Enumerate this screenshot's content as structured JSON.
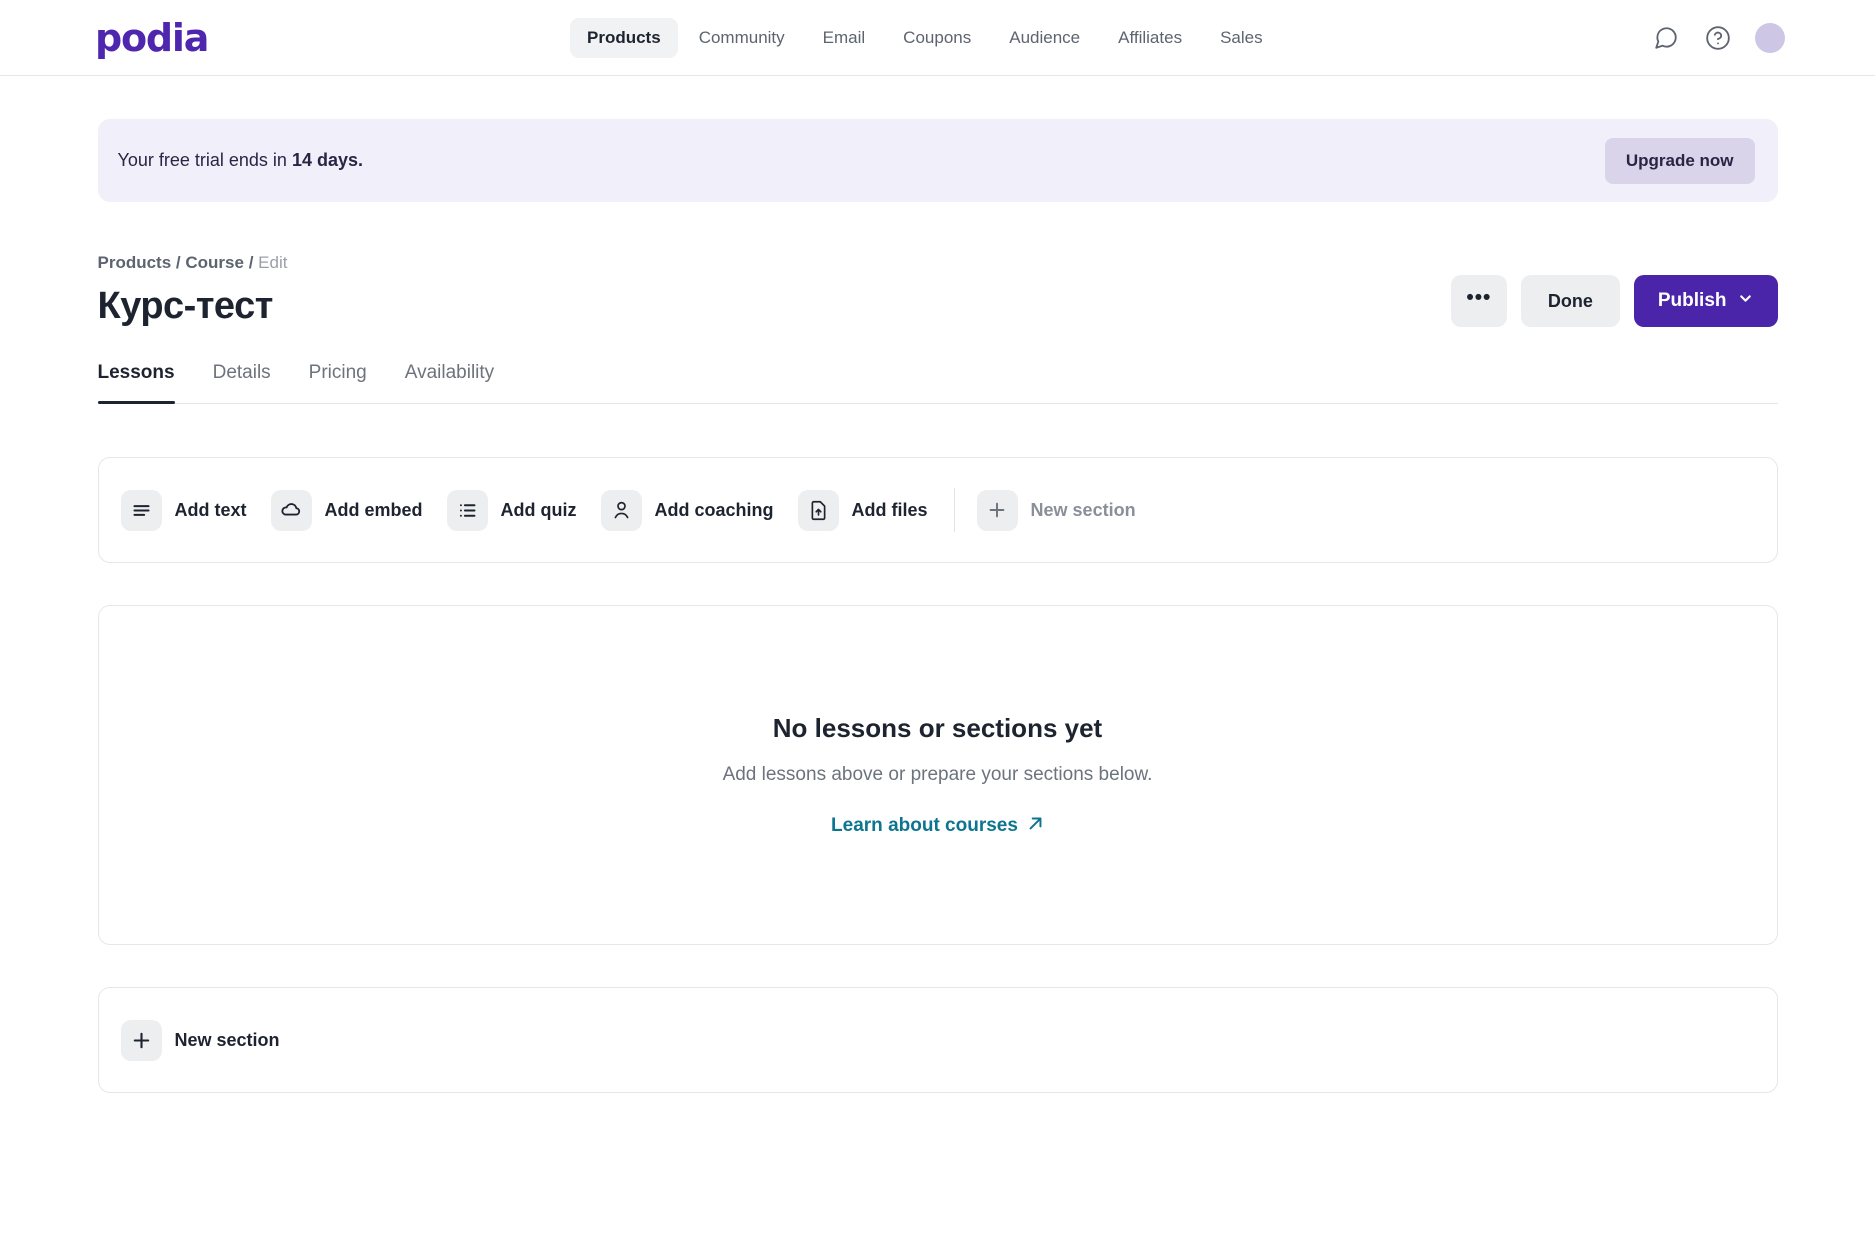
{
  "header": {
    "logo": "podia",
    "nav": [
      {
        "label": "Products",
        "active": true
      },
      {
        "label": "Community",
        "active": false
      },
      {
        "label": "Email",
        "active": false
      },
      {
        "label": "Coupons",
        "active": false
      },
      {
        "label": "Audience",
        "active": false
      },
      {
        "label": "Affiliates",
        "active": false
      },
      {
        "label": "Sales",
        "active": false
      }
    ],
    "icons": [
      "chat-bubble-icon",
      "help-circle-icon",
      "avatar"
    ]
  },
  "banner": {
    "text_prefix": "Your free trial ends in ",
    "text_strong": "14 days.",
    "upgrade_label": "Upgrade now",
    "background": "#f1eff9",
    "button_background": "#d9d4ea"
  },
  "breadcrumb": {
    "first": "Products",
    "second": "Course",
    "current": "Edit",
    "separator": "/"
  },
  "title": "Курс-тест",
  "actions": {
    "more_label": "•••",
    "done_label": "Done",
    "publish_label": "Publish",
    "publish_color": "#4a25aa"
  },
  "tabs": [
    {
      "label": "Lessons",
      "active": true
    },
    {
      "label": "Details",
      "active": false
    },
    {
      "label": "Pricing",
      "active": false
    },
    {
      "label": "Availability",
      "active": false
    }
  ],
  "toolbar": [
    {
      "label": "Add text",
      "icon": "lines-icon"
    },
    {
      "label": "Add embed",
      "icon": "cloud-icon"
    },
    {
      "label": "Add quiz",
      "icon": "list-icon"
    },
    {
      "label": "Add coaching",
      "icon": "person-icon"
    },
    {
      "label": "Add files",
      "icon": "file-upload-icon"
    },
    {
      "label": "New section",
      "icon": "plus-icon",
      "muted": true
    }
  ],
  "empty_state": {
    "title": "No lessons or sections yet",
    "subtitle": "Add lessons above or prepare your sections below.",
    "link_label": "Learn about courses",
    "link_color": "#0d7590"
  },
  "bottom_section": {
    "label": "New section",
    "icon": "plus-icon"
  }
}
